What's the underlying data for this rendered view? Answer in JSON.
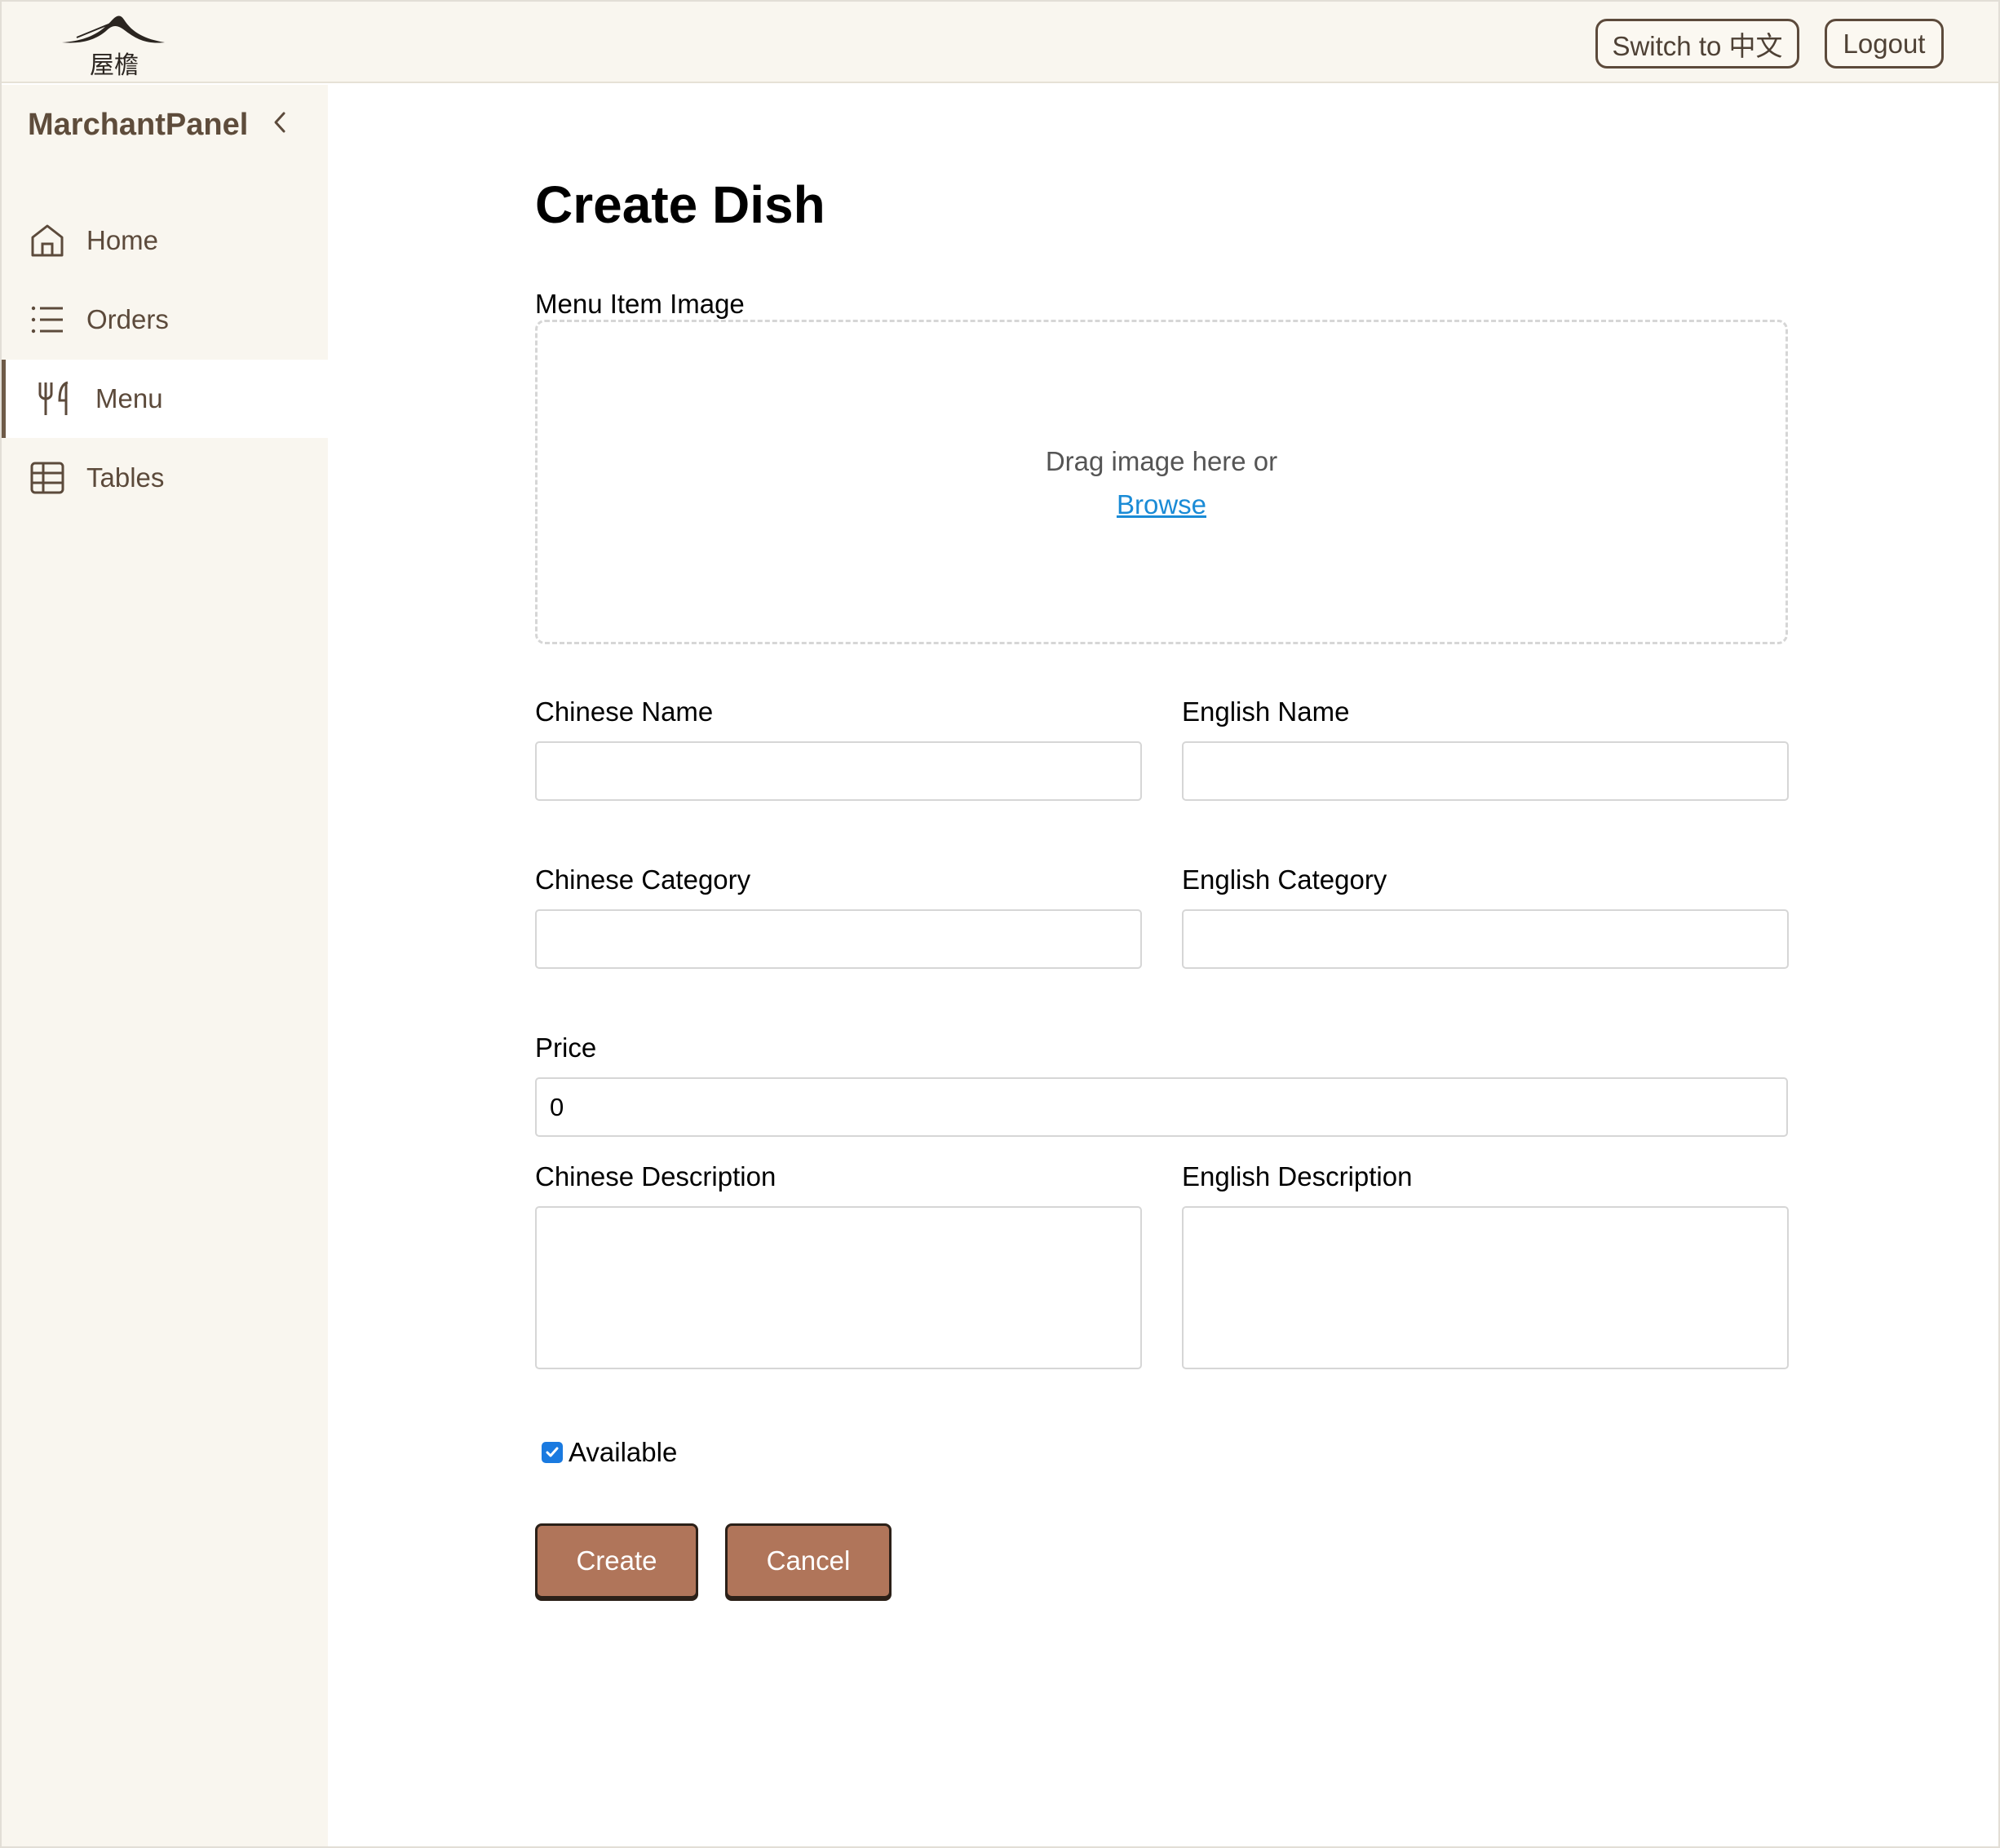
{
  "header": {
    "logo_icon": "pagoda-roof-logo",
    "switch_lang_label": "Switch to 中文",
    "logout_label": "Logout"
  },
  "sidebar": {
    "brand": "MarchantPanel",
    "collapse_icon": "chevron-left-icon",
    "items": [
      {
        "label": "Home",
        "icon": "home-icon"
      },
      {
        "label": "Orders",
        "icon": "list-icon"
      },
      {
        "label": "Menu",
        "icon": "fork-knife-icon",
        "active": true
      },
      {
        "label": "Tables",
        "icon": "grid-table-icon"
      }
    ]
  },
  "form": {
    "title": "Create Dish",
    "image_label": "Menu Item Image",
    "drop_text": "Drag image here or",
    "browse_label": "Browse",
    "chinese_name_label": "Chinese Name",
    "chinese_name_value": "",
    "english_name_label": "English Name",
    "english_name_value": "",
    "chinese_category_label": "Chinese Category",
    "chinese_category_value": "",
    "english_category_label": "English Category",
    "english_category_value": "",
    "price_label": "Price",
    "price_value": "0",
    "chinese_description_label": "Chinese Description",
    "english_description_label": "English Description",
    "available_label": "Available",
    "available_checked": true,
    "create_label": "Create",
    "cancel_label": "Cancel"
  },
  "colors": {
    "header_bg": "#f9f6ef",
    "sidebar_bg": "#f9f6ef",
    "brand_text": "#5e4c3b",
    "accent_button": "#b0755a",
    "link": "#1a8bd6",
    "checkbox": "#1a7ae0"
  }
}
